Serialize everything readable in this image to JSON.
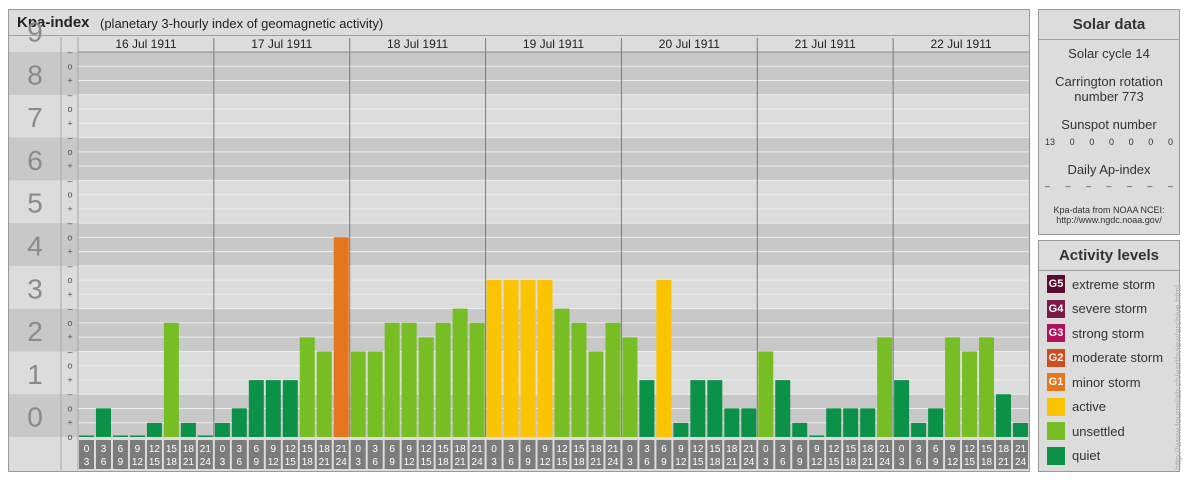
{
  "header": {
    "title": "Kpa-index",
    "subtitle": "(planetary 3-hourly index of geomagnetic activity)"
  },
  "colors": {
    "quiet": "#0c9148",
    "unsettled": "#77bd24",
    "active": "#fbc300",
    "G1": "#e6761b",
    "G2": "#d24d1e",
    "G3": "#b3105a",
    "G4": "#7b1a48",
    "G5": "#5a0b2e"
  },
  "chart_data": {
    "type": "bar",
    "title": "Kpa-index",
    "subtitle": "(planetary 3-hourly index of geomagnetic activity)",
    "ylim": [
      0,
      9
    ],
    "y_ticks": [
      "0",
      "1",
      "2",
      "3",
      "4",
      "5",
      "6",
      "7",
      "8",
      "9"
    ],
    "minor_tick_labels": [
      "+",
      "o",
      "–"
    ],
    "interval_start_labels": [
      "0",
      "3",
      "6",
      "9",
      "12",
      "15",
      "18",
      "21"
    ],
    "interval_end_labels": [
      "3",
      "6",
      "9",
      "12",
      "15",
      "18",
      "21",
      "24"
    ],
    "days": [
      {
        "date": "16 Jul 1911",
        "values": [
          0.0,
          0.67,
          0.0,
          0.0,
          0.33,
          2.67,
          0.33,
          0.0
        ]
      },
      {
        "date": "17 Jul 1911",
        "values": [
          0.33,
          0.67,
          1.33,
          1.33,
          1.33,
          2.33,
          2.0,
          4.67
        ]
      },
      {
        "date": "18 Jul 1911",
        "values": [
          2.0,
          2.0,
          2.67,
          2.67,
          2.33,
          2.67,
          3.0,
          2.67
        ]
      },
      {
        "date": "19 Jul 1911",
        "values": [
          3.67,
          3.67,
          3.67,
          3.67,
          3.0,
          2.67,
          2.0,
          2.67
        ]
      },
      {
        "date": "20 Jul 1911",
        "values": [
          2.33,
          1.33,
          3.67,
          0.33,
          1.33,
          1.33,
          0.67,
          0.67
        ]
      },
      {
        "date": "21 Jul 1911",
        "values": [
          2.0,
          1.33,
          0.33,
          0.0,
          0.67,
          0.67,
          0.67,
          2.33
        ]
      },
      {
        "date": "22 Jul 1911",
        "values": [
          1.33,
          0.33,
          0.67,
          2.33,
          2.0,
          2.33,
          1.0,
          0.33
        ]
      }
    ]
  },
  "solar": {
    "title": "Solar data",
    "cycle": "Solar cycle 14",
    "carrington_line1": "Carrington rotation",
    "carrington_line2": "number 773",
    "sunspot_title": "Sunspot number",
    "sunspots": [
      "13",
      "0",
      "0",
      "0",
      "0",
      "0",
      "0"
    ],
    "ap_title": "Daily Ap-index",
    "ap_values": [
      "–",
      "–",
      "–",
      "–",
      "–",
      "–",
      "–"
    ],
    "source_line1": "Kpa-data from NOAA NCEI:",
    "source_line2": "http://www.ngdc.noaa.gov/"
  },
  "activity": {
    "title": "Activity levels",
    "items": [
      {
        "badge": "G5",
        "label": "extreme storm",
        "color": "#5a0b2e"
      },
      {
        "badge": "G4",
        "label": "severe storm",
        "color": "#7b1a48"
      },
      {
        "badge": "G3",
        "label": "strong storm",
        "color": "#b3105a"
      },
      {
        "badge": "G2",
        "label": "moderate storm",
        "color": "#d24d1e"
      },
      {
        "badge": "G1",
        "label": "minor storm",
        "color": "#e6761b"
      },
      {
        "badge": "",
        "label": "active",
        "color": "#fbc300"
      },
      {
        "badge": "",
        "label": "unsettled",
        "color": "#77bd24"
      },
      {
        "badge": "",
        "label": "quiet",
        "color": "#0c9148"
      }
    ]
  },
  "watermark": "http://www.fourmilab.ch/earthview/archive.html"
}
